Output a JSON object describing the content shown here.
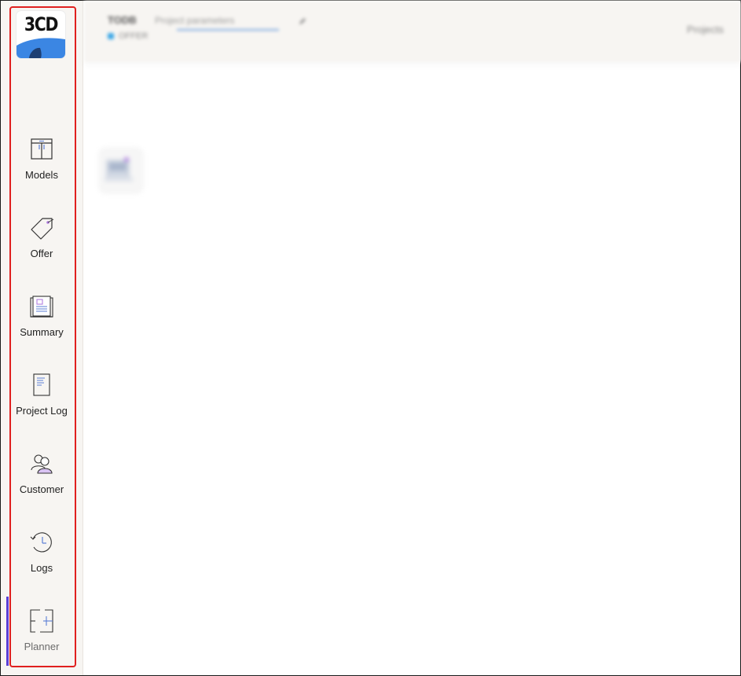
{
  "logo": {
    "text": "3CD",
    "accent_color": "#3b86e3",
    "dark_color": "#1d3f73"
  },
  "header": {
    "title": "TODB",
    "subtitle": "Project parameters",
    "status": "OFFER",
    "right_label": "Projects",
    "status_color": "#3aa6e6"
  },
  "sidebar": {
    "items": [
      {
        "label": "Models",
        "icon": "cabinet-icon"
      },
      {
        "label": "Offer",
        "icon": "price-tag-icon"
      },
      {
        "label": "Summary",
        "icon": "summary-document-icon"
      },
      {
        "label": "Project Log",
        "icon": "log-document-icon"
      },
      {
        "label": "Customer",
        "icon": "customers-icon"
      },
      {
        "label": "Logs",
        "icon": "history-clock-icon"
      },
      {
        "label": "Planner",
        "icon": "floor-plan-icon"
      }
    ],
    "active_item": "Planner",
    "active_color": "#5b3fd6",
    "highlight_color": "#e0201f"
  }
}
